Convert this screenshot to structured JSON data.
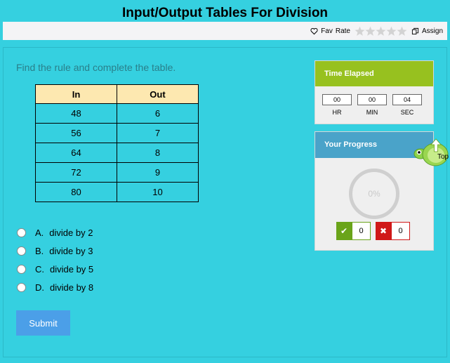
{
  "page": {
    "title": "Input/Output Tables For Division"
  },
  "toolbar": {
    "fav_label": "Fav",
    "rate_label": "Rate",
    "assign_label": "Assign"
  },
  "question": {
    "instruction": "Find the rule and complete the table."
  },
  "table": {
    "headers": [
      "In",
      "Out"
    ],
    "rows": [
      [
        "48",
        "6"
      ],
      [
        "56",
        "7"
      ],
      [
        "64",
        "8"
      ],
      [
        "72",
        "9"
      ],
      [
        "80",
        "10"
      ]
    ]
  },
  "options": [
    {
      "letter": "A.",
      "text": "divide by 2"
    },
    {
      "letter": "B.",
      "text": "divide by 3"
    },
    {
      "letter": "C.",
      "text": "divide by 5"
    },
    {
      "letter": "D.",
      "text": "divide by 8"
    }
  ],
  "submit_label": "Submit",
  "timer": {
    "title": "Time Elapsed",
    "hr": "00",
    "min": "00",
    "sec": "04",
    "hr_label": "HR",
    "min_label": "MIN",
    "sec_label": "SEC"
  },
  "progress": {
    "title": "Your Progress",
    "percent": "0%",
    "correct": "0",
    "wrong": "0"
  },
  "top_button": {
    "label": "Top"
  },
  "colors": {
    "background": "#35d0e0",
    "timer_header": "#97c11f",
    "progress_header": "#4aa3c9",
    "submit": "#4b9fe8",
    "table_header": "#fde8b0",
    "correct": "#6aa41a",
    "wrong": "#d01818"
  }
}
